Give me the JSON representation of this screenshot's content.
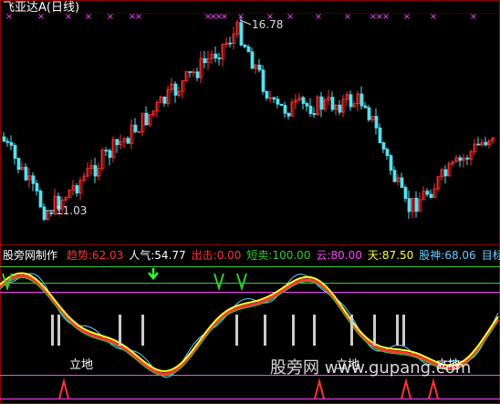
{
  "main_panel": {
    "title": "飞亚达A",
    "period": "(日线)",
    "high_label": "16.78",
    "low_label": "11.03",
    "marker_glyph": "×"
  },
  "indicator_panel": {
    "name": "股旁网制作",
    "values": [
      {
        "label": "趋势:",
        "value": "62.03",
        "color": "#ff3333"
      },
      {
        "label": "人气:",
        "value": "54.77",
        "color": "#ffffff"
      },
      {
        "label": "出击:",
        "value": "0.00",
        "color": "#ff3333"
      },
      {
        "label": "短卖:",
        "value": "100.00",
        "color": "#33cc33"
      },
      {
        "label": "云:",
        "value": "80.00",
        "color": "#ff44ff"
      },
      {
        "label": "天:",
        "value": "87.50",
        "color": "#ffff33"
      },
      {
        "label": "股神:",
        "value": "68.06",
        "color": "#66ccff"
      },
      {
        "label": "目标t",
        "value": "",
        "color": "#66ccff"
      }
    ],
    "signal_text": "立地",
    "watermark": "股旁网 www.gupang.com"
  },
  "colors": {
    "up": "#ff3333",
    "down": "#55e0ee",
    "marker": "#ff44ff",
    "grid": "#8b0000"
  }
}
